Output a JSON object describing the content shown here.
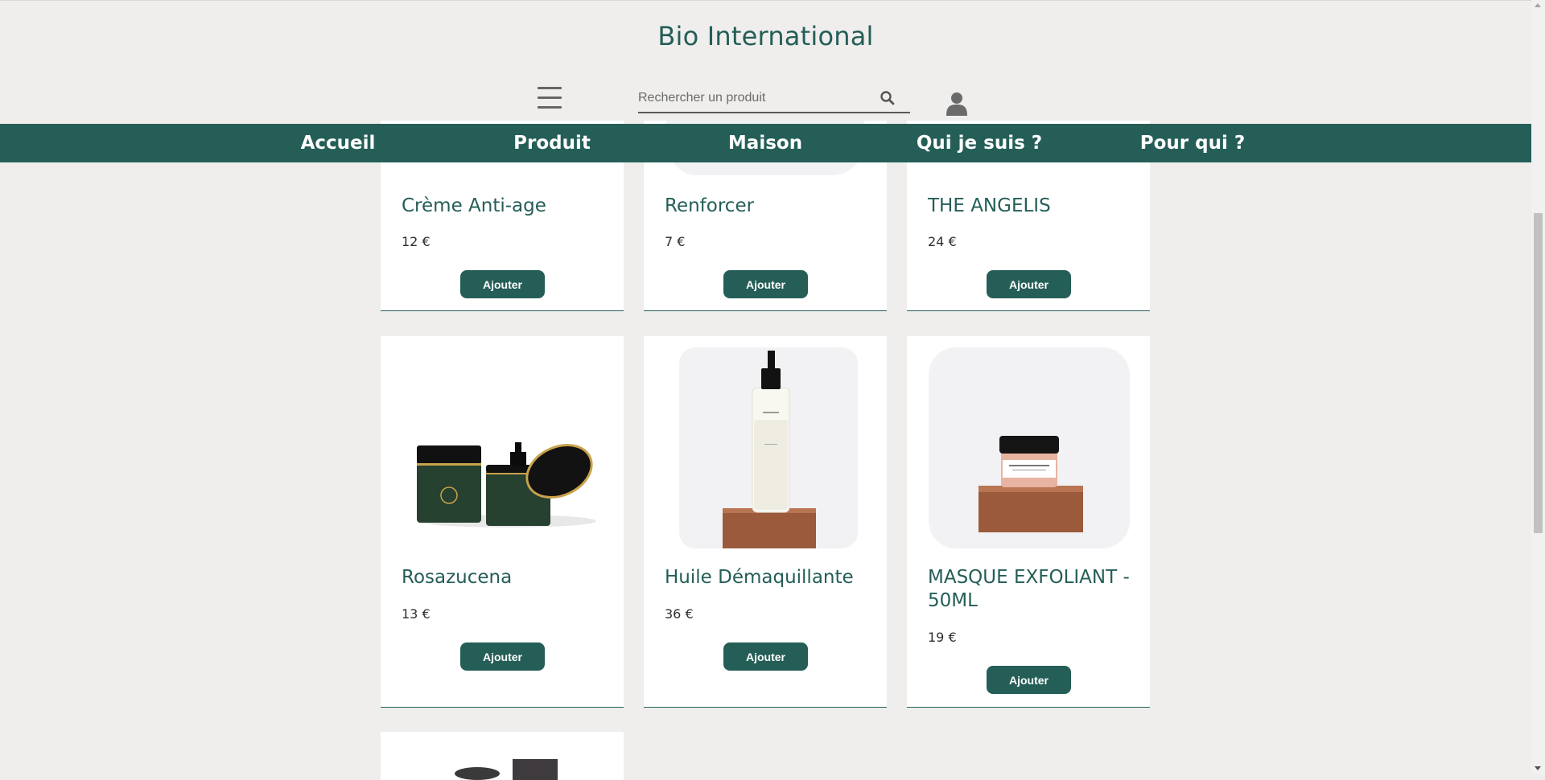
{
  "header": {
    "site_title": "Bio International",
    "search_placeholder": "Rechercher un produit"
  },
  "nav": {
    "items": [
      {
        "label": "Accueil"
      },
      {
        "label": "Produit"
      },
      {
        "label": "Maison"
      },
      {
        "label": "Qui je suis ?"
      },
      {
        "label": "Pour qui ?"
      }
    ]
  },
  "icons": {
    "menu": "hamburger-menu-icon",
    "search": "search-icon",
    "account": "user-icon"
  },
  "colors": {
    "brand": "#245e57",
    "background": "#efeeed",
    "card": "#ffffff"
  },
  "products": [
    {
      "name": "Crème Anti-age",
      "price": "12 €",
      "button": "Ajouter"
    },
    {
      "name": "Renforcer",
      "price": "7 €",
      "button": "Ajouter"
    },
    {
      "name": "THE ANGELIS",
      "price": "24 €",
      "button": "Ajouter"
    },
    {
      "name": "Rosazucena",
      "price": "13 €",
      "button": "Ajouter"
    },
    {
      "name": "Huile Démaquillante",
      "price": "36 €",
      "button": "Ajouter"
    },
    {
      "name": "MASQUE EXFOLIANT - 50ML",
      "price": "19 €",
      "button": "Ajouter"
    }
  ]
}
